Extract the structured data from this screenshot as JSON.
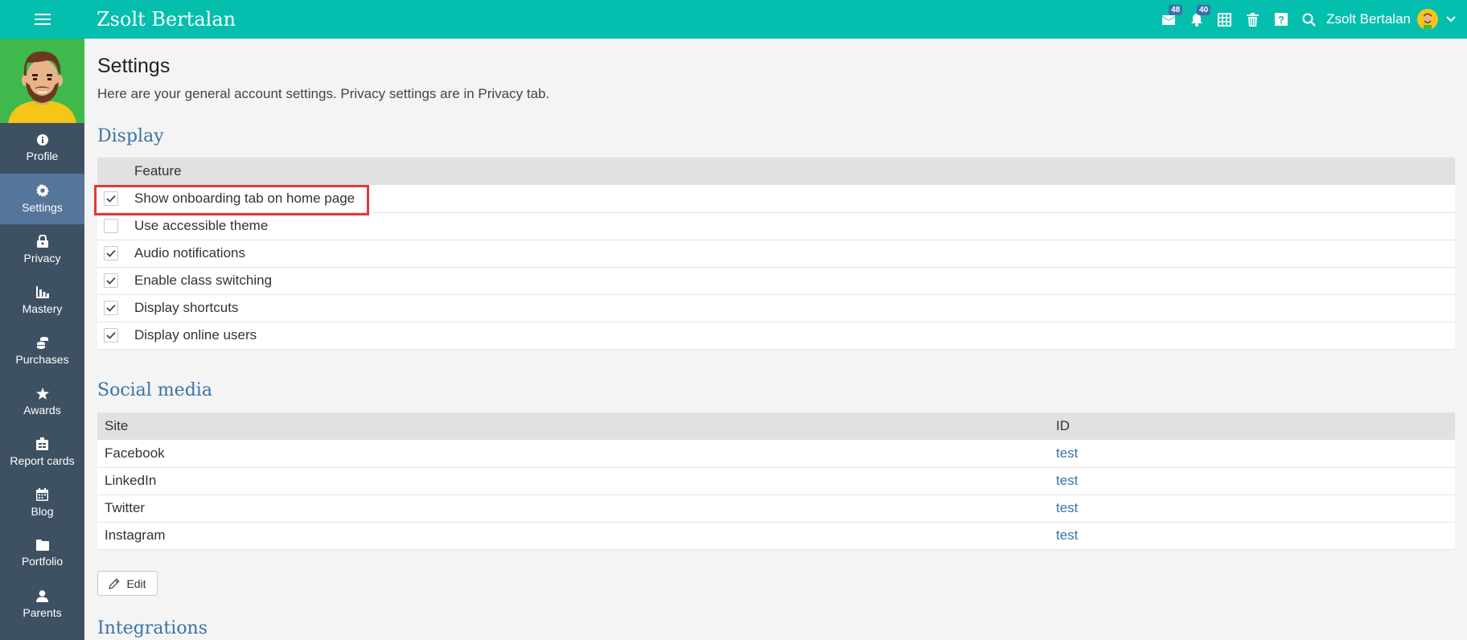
{
  "header": {
    "title": "Zsolt Bertalan",
    "messages_badge": "48",
    "notifications_badge": "40",
    "user_name": "Zsolt Bertalan"
  },
  "sidebar": {
    "items": [
      {
        "label": "Profile",
        "icon": "info-icon"
      },
      {
        "label": "Settings",
        "icon": "gear-icon"
      },
      {
        "label": "Privacy",
        "icon": "lock-icon"
      },
      {
        "label": "Mastery",
        "icon": "bar-chart-icon"
      },
      {
        "label": "Purchases",
        "icon": "coins-icon"
      },
      {
        "label": "Awards",
        "icon": "star-icon"
      },
      {
        "label": "Report cards",
        "icon": "report-card-icon"
      },
      {
        "label": "Blog",
        "icon": "calendar-icon"
      },
      {
        "label": "Portfolio",
        "icon": "folder-icon"
      },
      {
        "label": "Parents",
        "icon": "person-icon"
      }
    ],
    "active": "Settings"
  },
  "main": {
    "title": "Settings",
    "description": "Here are your general account settings. Privacy settings are in Privacy tab.",
    "display": {
      "heading": "Display",
      "column_header": "Feature",
      "features": [
        {
          "label": "Show onboarding tab on home page",
          "checked": true
        },
        {
          "label": "Use accessible theme",
          "checked": false
        },
        {
          "label": "Audio notifications",
          "checked": true
        },
        {
          "label": "Enable class switching",
          "checked": true
        },
        {
          "label": "Display shortcuts",
          "checked": true
        },
        {
          "label": "Display online users",
          "checked": true
        }
      ]
    },
    "social": {
      "heading": "Social media",
      "col_site": "Site",
      "col_id": "ID",
      "rows": [
        {
          "site": "Facebook",
          "id": "test"
        },
        {
          "site": "LinkedIn",
          "id": "test"
        },
        {
          "site": "Twitter",
          "id": "test"
        },
        {
          "site": "Instagram",
          "id": "test"
        }
      ]
    },
    "edit_label": "Edit",
    "integrations_heading": "Integrations"
  },
  "colors": {
    "topbar": "#04bfae",
    "sidebar": "#3e5163",
    "sidebar_active": "#56759a",
    "link": "#3a73a6",
    "highlight": "#e53935"
  }
}
